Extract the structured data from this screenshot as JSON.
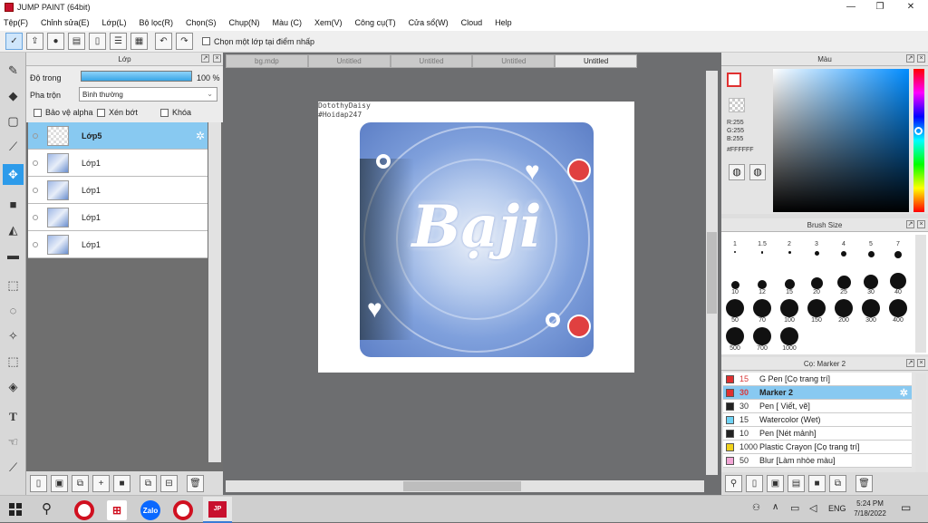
{
  "window": {
    "title": "JUMP PAINT (64bit)"
  },
  "menu": [
    "Tệp(F)",
    "Chỉnh sửa(E)",
    "Lớp(L)",
    "Bộ lọc(R)",
    "Chọn(S)",
    "Chụp(N)",
    "Màu (C)",
    "Xem(V)",
    "Công cụ(T)",
    "Cửa sổ(W)",
    "Cloud",
    "Help"
  ],
  "toolbar": {
    "pick_layer_label": "Chọn một lớp tại điểm nhấp"
  },
  "layer_panel": {
    "title": "Lớp",
    "opacity_label": "Độ trong",
    "opacity_value": "100 %",
    "opacity_fraction": 1.0,
    "blend_label": "Pha trộn",
    "blend_value": "Bình thường",
    "protect_alpha": "Bảo vệ alpha",
    "clipping": "Xén bớt",
    "lock": "Khóa",
    "layers": [
      {
        "name": "Lớp5",
        "selected": true
      },
      {
        "name": "Lớp1",
        "selected": false
      },
      {
        "name": "Lớp1",
        "selected": false
      },
      {
        "name": "Lớp1",
        "selected": false
      },
      {
        "name": "Lớp1",
        "selected": false
      }
    ]
  },
  "doc_tabs": [
    "bg.mdp",
    "Untitled",
    "Untitled",
    "Untitled",
    "Untitled"
  ],
  "canvas": {
    "watermark_line1": "DotothyDaisy",
    "watermark_line2": "#Hoidap247",
    "artwork_text": "Bạji"
  },
  "color_panel": {
    "title": "Màu",
    "r": "R:255",
    "g": "G:255",
    "b": "B:255",
    "hex": "#FFFFFF",
    "fg_color": "#e03030"
  },
  "brush_size_panel": {
    "title": "Brush Size",
    "sizes": [
      "1",
      "1.5",
      "2",
      "3",
      "4",
      "5",
      "7",
      "10",
      "12",
      "15",
      "20",
      "25",
      "30",
      "40",
      "50",
      "70",
      "100",
      "150",
      "200",
      "300",
      "400",
      "500",
      "700",
      "1000"
    ]
  },
  "brush_panel": {
    "title": "Cọ: Marker 2",
    "brushes": [
      {
        "size": "15",
        "name": "G Pen [Cọ trang trí]",
        "color": "#e03030",
        "selected": false
      },
      {
        "size": "30",
        "name": "Marker 2",
        "color": "#e03030",
        "selected": true
      },
      {
        "size": "30",
        "name": "Pen [ Viết, vẽ]",
        "color": "#222222",
        "selected": false
      },
      {
        "size": "15",
        "name": "Watercolor (Wet)",
        "color": "#6fd3f5",
        "selected": false
      },
      {
        "size": "10",
        "name": "Pen [Nét mảnh]",
        "color": "#222222",
        "selected": false
      },
      {
        "size": "1000",
        "name": "Plastic Crayon [Cọ trang trí]",
        "color": "#f1d21b",
        "selected": false
      },
      {
        "size": "50",
        "name": "Blur [Làm nhòe màu]",
        "color": "#f3a6d6",
        "selected": false
      }
    ]
  },
  "taskbar": {
    "time": "5:24 PM",
    "date": "7/18/2022",
    "lang": "ENG",
    "zalo": "Zalo"
  }
}
